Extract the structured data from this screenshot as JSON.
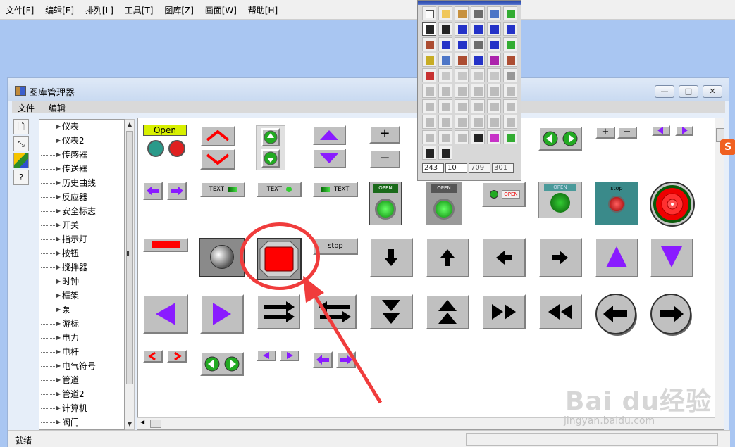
{
  "app_menu": [
    "文件[F]",
    "编辑[E]",
    "排列[L]",
    "工具[T]",
    "图库[Z]",
    "画面[W]",
    "帮助[H]"
  ],
  "library_window": {
    "title": "图库管理器",
    "menu": [
      "文件",
      "编辑"
    ],
    "controls": {
      "minimize": "—",
      "maximize": "□",
      "close": "✕"
    },
    "status": "就绪"
  },
  "tree": {
    "items": [
      "仪表",
      "仪表2",
      "传感器",
      "传送器",
      "历史曲线",
      "反应器",
      "安全标志",
      "开关",
      "指示灯",
      "按钮",
      "搅拌器",
      "时钟",
      "框架",
      "泵",
      "游标",
      "电力",
      "电杆",
      "电气符号",
      "管道",
      "管道2",
      "计算机",
      "阀门"
    ]
  },
  "gallery": {
    "open_label": "Open",
    "text_label": "TEXT",
    "stop_label": "stop",
    "open_small": "OPEN",
    "plus": "+",
    "minus": "−"
  },
  "toolbox": {
    "coords": [
      "243",
      "10",
      "709",
      "301"
    ]
  },
  "watermark": {
    "badge": "S",
    "logo": "Bai du经验",
    "url": "jingyan.baidu.com"
  },
  "colors": {
    "accent_red": "#ff0000",
    "purple": "#8a1bff",
    "green": "#22cc22",
    "annotation": "#f03c3c"
  }
}
